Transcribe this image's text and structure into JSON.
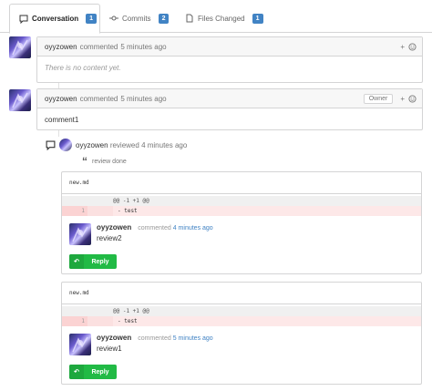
{
  "tabs": [
    {
      "label": "Conversation",
      "count": "1"
    },
    {
      "label": "Commits",
      "count": "2"
    },
    {
      "label": "Files Changed",
      "count": "1"
    }
  ],
  "comment1": {
    "author": "oyyzowen",
    "action": "commented",
    "time": "5 minutes ago",
    "body": "There is no content yet."
  },
  "comment2": {
    "author": "oyyzowen",
    "action": "commented",
    "time": "5 minutes ago",
    "owner_label": "Owner",
    "body": "comment1"
  },
  "review": {
    "author": "oyyzowen",
    "action": "reviewed",
    "time": "4 minutes ago",
    "summary": "review done"
  },
  "code_comments": [
    {
      "file": "new.md",
      "hunk": "@@ -1 +1 @@",
      "line_no": "1",
      "line_code": "- test",
      "author": "oyyzowen",
      "action": "commented",
      "time": "4 minutes ago",
      "body": "review2",
      "reply_label": "Reply"
    },
    {
      "file": "new.md",
      "hunk": "@@ -1 +1 @@",
      "line_no": "1",
      "line_code": "- test",
      "author": "oyyzowen",
      "action": "commented",
      "time": "5 minutes ago",
      "body": "review1",
      "reply_label": "Reply"
    }
  ],
  "colors": {
    "accent": "#4183c4",
    "reply_green": "#21ba45",
    "deleted_bg": "#fde8e8"
  },
  "icons": {
    "conversation": "speech-bubble-icon",
    "commits": "commit-icon",
    "files": "file-icon",
    "react": "smiley-icon",
    "add": "plus-icon",
    "review": "comment-icon",
    "quote": "quote-icon",
    "reply": "reply-arrow-icon"
  }
}
